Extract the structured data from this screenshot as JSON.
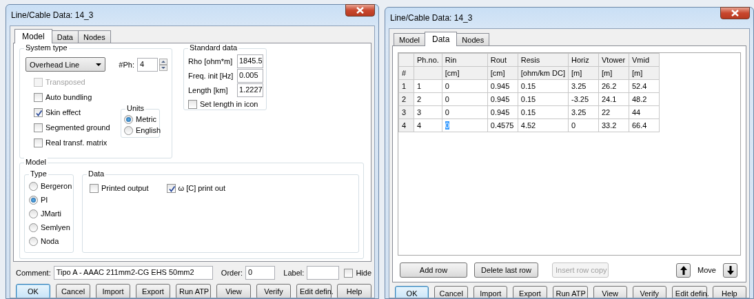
{
  "dialogs": [
    {
      "title": "Line/Cable Data: 14_3",
      "tabs": [
        {
          "label": "Model",
          "selected": true
        },
        {
          "label": "Data",
          "selected": false
        },
        {
          "label": "Nodes",
          "selected": false
        }
      ],
      "panel": {
        "kind": "model",
        "system_type": {
          "heading": "System type",
          "dropdown": "Overhead Line",
          "phases_label": "#Ph:",
          "phases": "4",
          "options": [
            {
              "label": "Transposed",
              "checked": false,
              "disabled": true
            },
            {
              "label": "Auto bundling",
              "checked": false,
              "disabled": false
            },
            {
              "label": "Skin effect",
              "checked": true,
              "disabled": false
            },
            {
              "label": "Segmented ground",
              "checked": false,
              "disabled": false
            },
            {
              "label": "Real transf. matrix",
              "checked": false,
              "disabled": false
            }
          ],
          "units": {
            "heading": "Units",
            "options": [
              {
                "label": "Metric",
                "selected": true
              },
              {
                "label": "English",
                "selected": false
              }
            ]
          }
        },
        "standard_data": {
          "heading": "Standard data",
          "fields": [
            {
              "label": "Rho [ohm*m]",
              "value": "1845.5"
            },
            {
              "label": "Freq. init [Hz]",
              "value": "0.005"
            },
            {
              "label": "Length [km]",
              "value": "1.2227"
            }
          ],
          "set_length": {
            "label": "Set length in icon",
            "checked": false
          }
        },
        "model": {
          "heading": "Model",
          "type": {
            "heading": "Type",
            "options": [
              {
                "label": "Bergeron",
                "selected": false
              },
              {
                "label": "PI",
                "selected": true
              },
              {
                "label": "JMarti",
                "selected": false
              },
              {
                "label": "Semlyen",
                "selected": false
              },
              {
                "label": "Noda",
                "selected": false
              }
            ]
          },
          "data": {
            "heading": "Data",
            "options": [
              {
                "label": "Printed output",
                "checked": false
              },
              {
                "label": "ω [C] print out",
                "checked": true
              }
            ]
          }
        }
      },
      "footer": {
        "comment": {
          "label": "Comment:",
          "value": "Tipo A - AAAC 211mm2-CG EHS 50mm2"
        },
        "order": {
          "label": "Order:",
          "value": "0"
        },
        "label_field": {
          "label": "Label:"
        },
        "hide": {
          "label": "Hide",
          "checked": false
        }
      },
      "buttons": [
        {
          "label": "OK",
          "default": true
        },
        {
          "label": "Cancel",
          "default": false
        },
        {
          "label": "Import",
          "default": false
        },
        {
          "label": "Export",
          "default": false
        },
        {
          "label": "Run ATP",
          "default": false
        },
        {
          "label": "View",
          "default": false
        },
        {
          "label": "Verify",
          "default": false
        },
        {
          "label": "Edit defin.",
          "default": false
        },
        {
          "label": "Help",
          "default": false
        }
      ]
    },
    {
      "title": "Line/Cable Data: 14_3",
      "tabs": [
        {
          "label": "Model",
          "selected": false
        },
        {
          "label": "Data",
          "selected": true
        },
        {
          "label": "Nodes",
          "selected": false
        }
      ],
      "panel": {
        "kind": "data",
        "columns": [
          {
            "unit": "#"
          },
          {
            "name": "Ph.no."
          },
          {
            "name": "Rin",
            "unit": "[cm]"
          },
          {
            "name": "Rout",
            "unit": "[cm]"
          },
          {
            "name": "Resis",
            "unit": "[ohm/km DC]"
          },
          {
            "name": "Horiz",
            "unit": "[m]"
          },
          {
            "name": "Vtower",
            "unit": "[m]"
          },
          {
            "name": "Vmid",
            "unit": "[m]"
          }
        ],
        "rows": [
          {
            "cells": [
              {
                "text": "1",
                "selected": false
              },
              {
                "text": "1",
                "selected": false
              },
              {
                "text": "0",
                "selected": false
              },
              {
                "text": "0.945",
                "selected": false
              },
              {
                "text": "0.15",
                "selected": false
              },
              {
                "text": "3.25",
                "selected": false
              },
              {
                "text": "26.2",
                "selected": false
              },
              {
                "text": "52.4",
                "selected": false
              }
            ]
          },
          {
            "cells": [
              {
                "text": "2",
                "selected": false
              },
              {
                "text": "2",
                "selected": false
              },
              {
                "text": "0",
                "selected": false
              },
              {
                "text": "0.945",
                "selected": false
              },
              {
                "text": "0.15",
                "selected": false
              },
              {
                "text": "-3.25",
                "selected": false
              },
              {
                "text": "24.1",
                "selected": false
              },
              {
                "text": "48.2",
                "selected": false
              }
            ]
          },
          {
            "cells": [
              {
                "text": "3",
                "selected": false
              },
              {
                "text": "3",
                "selected": false
              },
              {
                "text": "0",
                "selected": false
              },
              {
                "text": "0.945",
                "selected": false
              },
              {
                "text": "0.15",
                "selected": false
              },
              {
                "text": "3.25",
                "selected": false
              },
              {
                "text": "22",
                "selected": false
              },
              {
                "text": "44",
                "selected": false
              }
            ]
          },
          {
            "cells": [
              {
                "text": "4",
                "selected": false
              },
              {
                "text": "4",
                "selected": false
              },
              {
                "text": "0",
                "selected": true
              },
              {
                "text": "0.4575",
                "selected": false
              },
              {
                "text": "4.52",
                "selected": false
              },
              {
                "text": "0",
                "selected": false
              },
              {
                "text": "33.2",
                "selected": false
              },
              {
                "text": "66.4",
                "selected": false
              }
            ]
          }
        ],
        "row_buttons": [
          {
            "label": "Add row",
            "disabled": false
          },
          {
            "label": "Delete last row",
            "disabled": false
          },
          {
            "label": "Insert row copy",
            "disabled": true
          }
        ],
        "move_label": "Move"
      },
      "buttons": [
        {
          "label": "OK",
          "default": true
        },
        {
          "label": "Cancel",
          "default": false
        },
        {
          "label": "Import",
          "default": false
        },
        {
          "label": "Export",
          "default": false
        },
        {
          "label": "Run ATP",
          "default": false
        },
        {
          "label": "View",
          "default": false
        },
        {
          "label": "Verify",
          "default": false
        },
        {
          "label": "Edit defin.",
          "default": false
        },
        {
          "label": "Help",
          "default": false
        }
      ]
    }
  ]
}
